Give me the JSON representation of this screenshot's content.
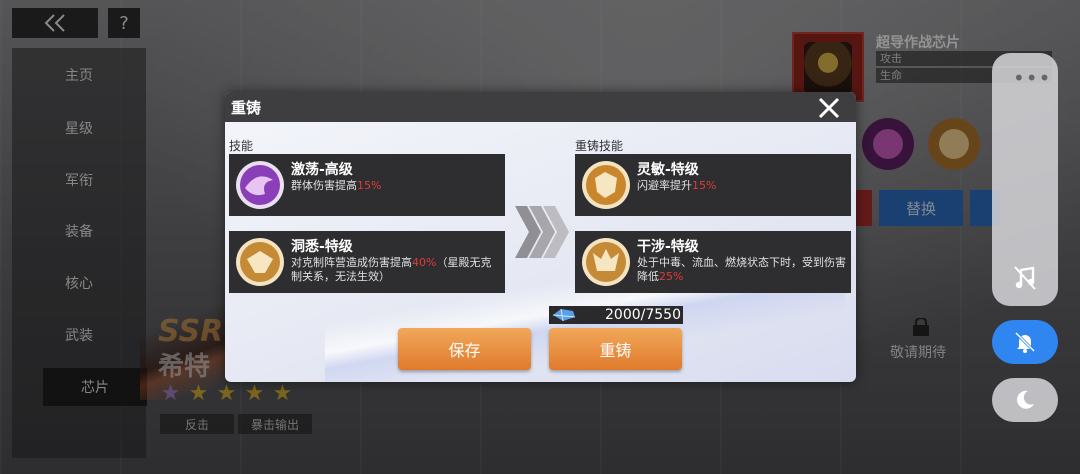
{
  "background": {
    "nav": {
      "back_icon": "double-chevron-left-icon",
      "help_label": "?"
    },
    "side_menu": [
      {
        "label": "主页",
        "active": false
      },
      {
        "label": "星级",
        "active": false
      },
      {
        "label": "军衔",
        "active": false
      },
      {
        "label": "装备",
        "active": false
      },
      {
        "label": "核心",
        "active": false
      },
      {
        "label": "武装",
        "active": false
      },
      {
        "label": "芯片",
        "active": true
      }
    ],
    "character": {
      "rank": "SSR",
      "name": "希特",
      "stars": 5,
      "tags": [
        "反击",
        "暴击输出"
      ]
    },
    "chip_panel": {
      "title": "超导作战芯片",
      "stats": [
        "攻击",
        "生命"
      ],
      "replace_label": "替换",
      "coming_soon": "敬请期待"
    },
    "colors": {
      "accent_blue": "#2b66b6",
      "accent_red": "#a12a2a"
    }
  },
  "side_controls": {
    "more_icon": "more-dots-icon",
    "music_icon": "music-off-icon",
    "mute_icon": "bell-off-icon",
    "night_icon": "moon-icon",
    "mute_color": "#2f86f0"
  },
  "modal": {
    "title": "重铸",
    "close_icon": "close-x-icon",
    "current": {
      "label": "技能",
      "skills": [
        {
          "name": "激荡-高级",
          "desc_prefix": "群体伤害提高",
          "value": "15%",
          "desc_suffix": "",
          "icon": "purple-swirl-skill-icon"
        },
        {
          "name": "洞悉-特级",
          "desc_prefix": "对克制阵营造成伤害提高",
          "value": "40%",
          "desc_suffix": "（星殿无克制关系，无法生效）",
          "icon": "gold-bird-skill-icon"
        }
      ]
    },
    "recast": {
      "label": "重铸技能",
      "skills": [
        {
          "name": "灵敏-特级",
          "desc_prefix": "闪避率提升",
          "value": "15%",
          "desc_suffix": "",
          "icon": "gold-tiger-skill-icon"
        },
        {
          "name": "干涉-特级",
          "desc_prefix": "处于中毒、流血、燃烧状态下时，受到伤害降低",
          "value": "25%",
          "desc_suffix": "",
          "icon": "gold-beast-skill-icon"
        }
      ]
    },
    "cost": {
      "text": "2000/7550",
      "current": 2000,
      "required": 7550,
      "icon": "crystal-currency-icon"
    },
    "save_label": "保存",
    "recast_label": "重铸",
    "colors": {
      "button": "#e88d3f",
      "highlight": "#e03a3a"
    }
  }
}
